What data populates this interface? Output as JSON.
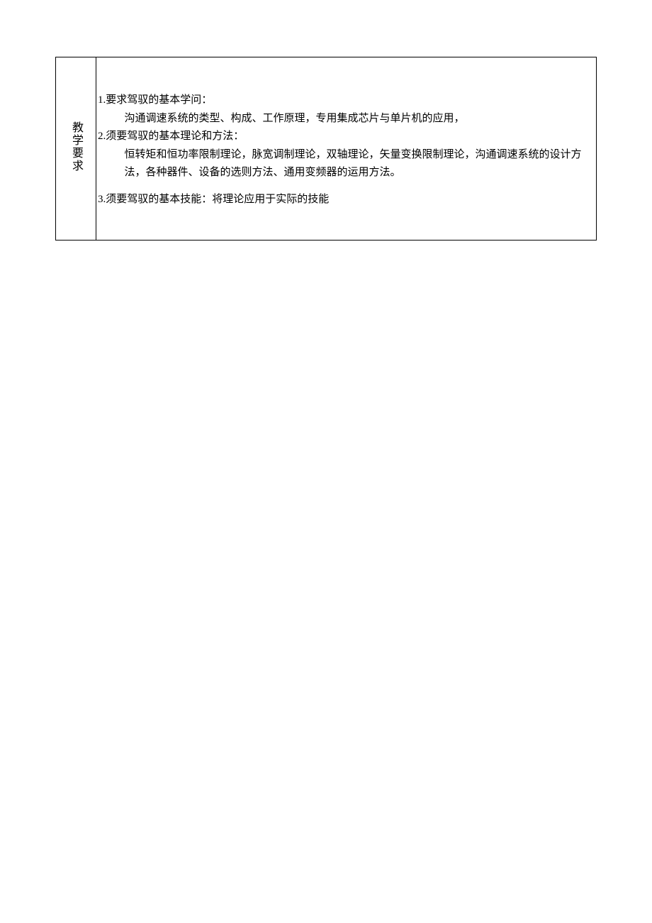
{
  "label": "教学要求",
  "item1_title": "1.要求驾驭的基本学问：",
  "item1_body": "沟通调速系统的类型、构成、工作原理，专用集成芯片与单片机的应用，",
  "item2_title": "2.须要驾驭的基本理论和方法：",
  "item2_body": "恒转矩和恒功率限制理论，脉宽调制理论，双轴理论，矢量变换限制理论，沟通调速系统的设计方法，各种器件、设备的选则方法、通用变频器的运用方法。",
  "item3": "3.须要驾驭的基本技能：将理论应用于实际的技能"
}
